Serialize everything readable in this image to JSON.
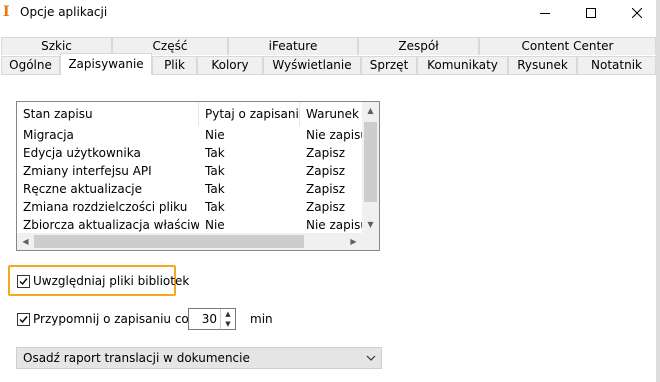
{
  "window": {
    "title": "Opcje aplikacji",
    "app_icon": "I",
    "minimize_icon": "minimize-icon",
    "maximize_icon": "maximize-icon",
    "close_icon": "close-icon"
  },
  "tabs": {
    "row1": [
      "Szkic",
      "Część",
      "iFeature",
      "Zespół",
      "Content Center"
    ],
    "row2": [
      "Ogólne",
      "Zapisywanie",
      "Plik",
      "Kolory",
      "Wyświetlanie",
      "Sprzęt",
      "Komunikaty",
      "Rysunek",
      "Notatnik"
    ],
    "active": "Zapisywanie"
  },
  "list": {
    "columns": [
      "Stan zapisu",
      "Pytaj o zapisanie",
      "Warunek z"
    ],
    "rows": [
      [
        "Migracja",
        "Nie",
        "Nie zapisuj"
      ],
      [
        "Edycja użytkownika",
        "Tak",
        "Zapisz"
      ],
      [
        "Zmiany interfejsu API",
        "Tak",
        "Zapisz"
      ],
      [
        "Ręczne aktualizacje",
        "Tak",
        "Zapisz"
      ],
      [
        "Zmiana rozdzielczości pliku",
        "Tak",
        "Zapisz"
      ],
      [
        "Zbiorcza aktualizacja właściwości",
        "Nie",
        "Nie zapisuj"
      ]
    ]
  },
  "options": {
    "include_libraries_label": "Uwzględniaj pliki bibliotek",
    "include_libraries_checked": true,
    "remind_label": "Przypomnij o zapisaniu co:",
    "remind_checked": true,
    "remind_value": "30",
    "remind_unit": "min"
  },
  "combo": {
    "selected": "Osadź raport translacji w dokumencie"
  },
  "colors": {
    "highlight": "#f5a623",
    "accent_icon": "#e8790a"
  }
}
